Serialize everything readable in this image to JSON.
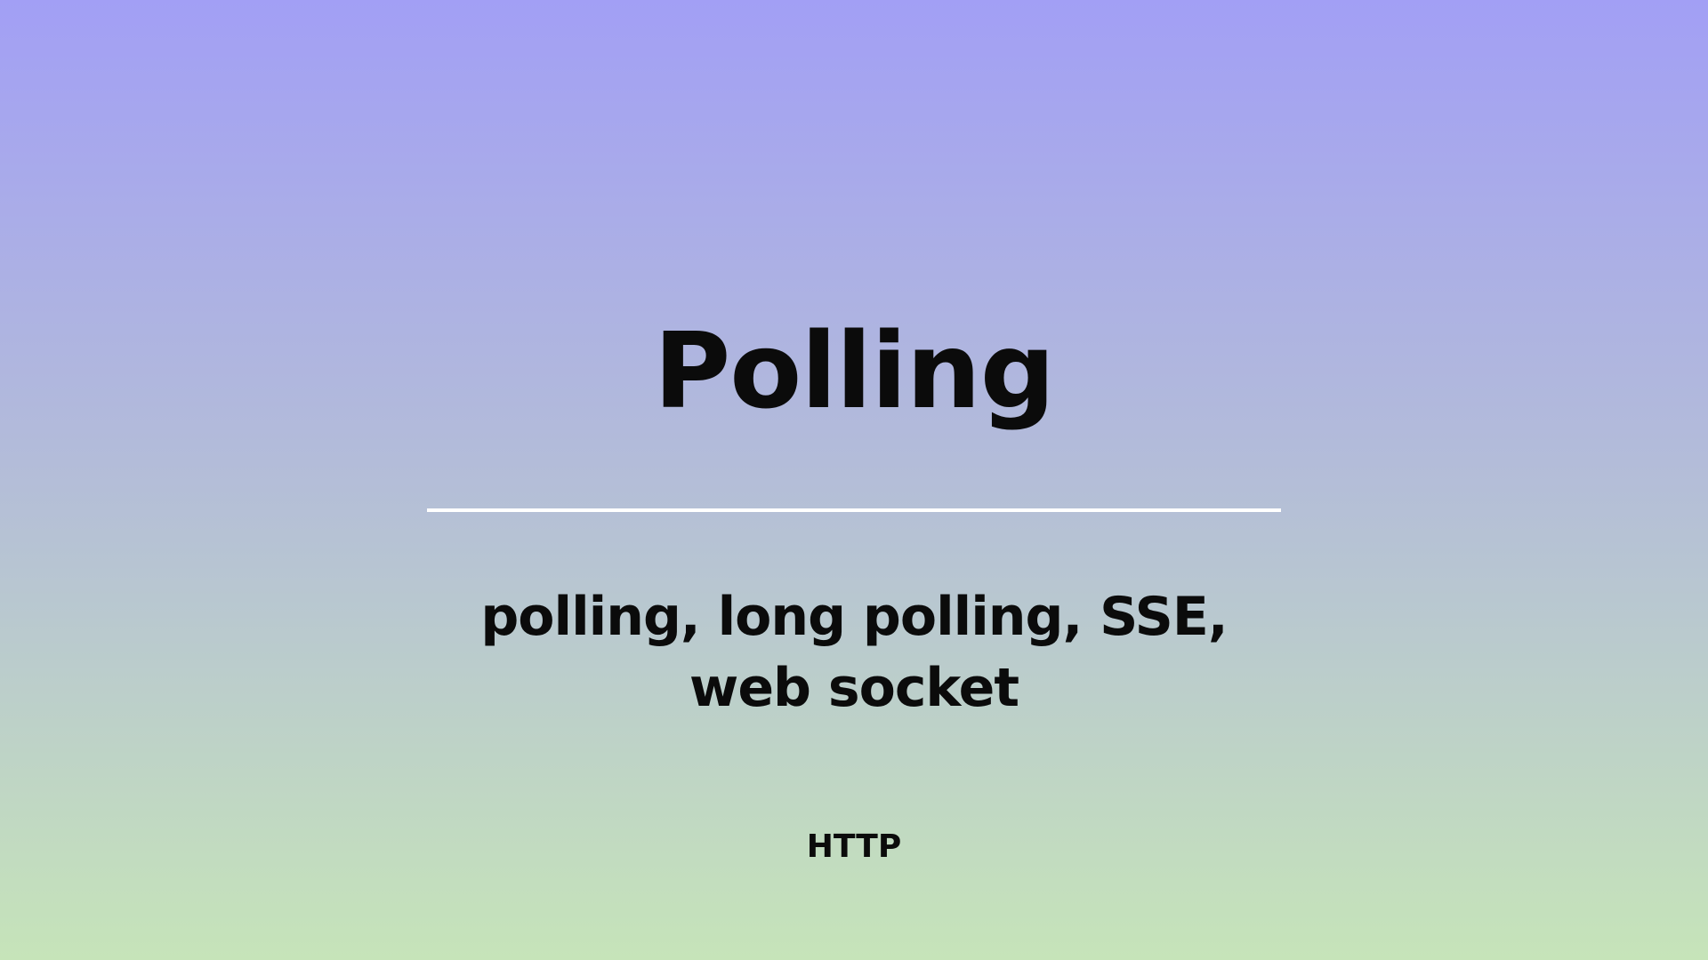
{
  "slide": {
    "title": "Polling",
    "subtitle": "polling, long polling, SSE, web socket",
    "footer": "HTTP"
  }
}
